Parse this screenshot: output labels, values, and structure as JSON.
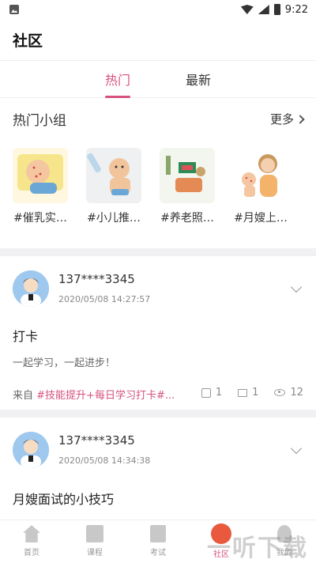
{
  "status_bar": {
    "time": "9:22"
  },
  "header": {
    "title": "社区"
  },
  "tabs": [
    {
      "label": "热门",
      "active": true
    },
    {
      "label": "最新",
      "active": false
    }
  ],
  "hot_groups": {
    "title": "热门小组",
    "more_label": "更多",
    "items": [
      {
        "label": "#催乳实…"
      },
      {
        "label": "#小儿推…"
      },
      {
        "label": "#养老照…"
      },
      {
        "label": "#月嫂上…"
      }
    ]
  },
  "posts": [
    {
      "user": "137****3345",
      "time": "2020/05/08 14:27:57",
      "title": "打卡",
      "body": "一起学习，一起进步！",
      "from_label": "来自",
      "tags": "#技能提升+每日学习打卡#...",
      "likes": "1",
      "comments": "1",
      "views": "12"
    },
    {
      "user": "137****3345",
      "time": "2020/05/08 14:34:38",
      "title": "月嫂面试的小技巧"
    }
  ],
  "bottom_nav": [
    {
      "label": "首页",
      "icon": "home-icon",
      "active": false
    },
    {
      "label": "课程",
      "icon": "book-icon",
      "active": false
    },
    {
      "label": "考试",
      "icon": "exam-icon",
      "active": false
    },
    {
      "label": "社区",
      "icon": "community-icon",
      "active": true
    },
    {
      "label": "我的",
      "icon": "person-icon",
      "active": false
    }
  ],
  "watermark": "一听下载",
  "colors": {
    "accent": "#d6517f",
    "divider": "#f1f1f3"
  }
}
